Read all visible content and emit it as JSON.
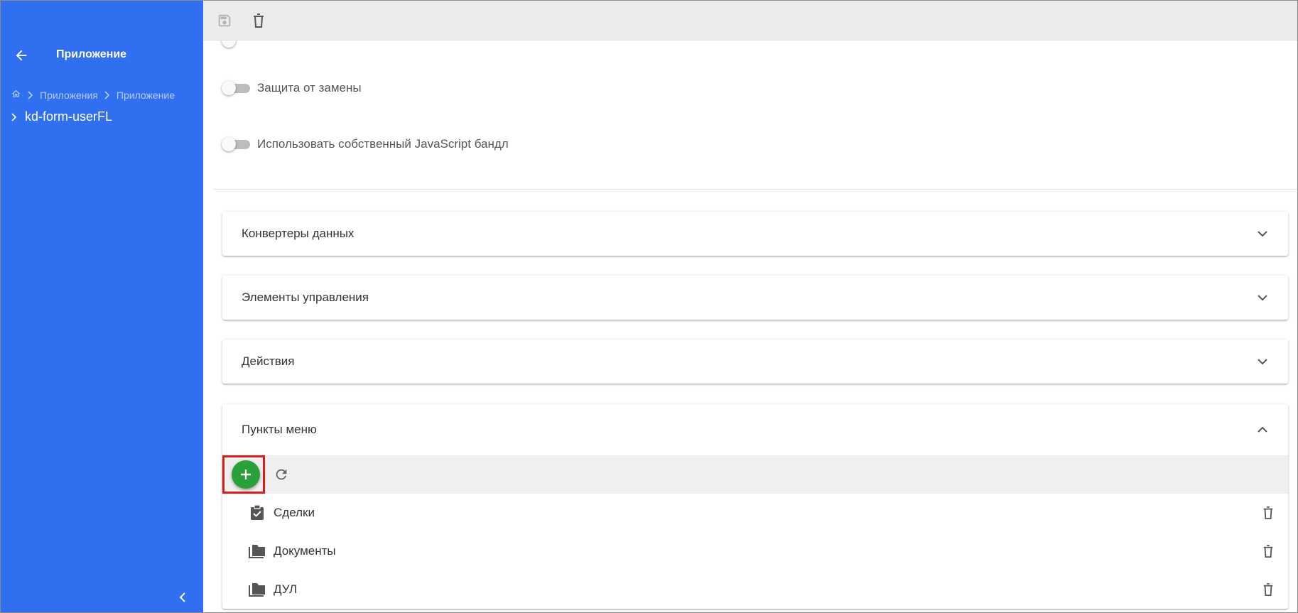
{
  "sidebar": {
    "title": "Приложение",
    "breadcrumb": [
      "Приложения",
      "Приложение"
    ],
    "tree_item": "kd-form-userFL",
    "icons": {
      "back": "arrow-left-icon",
      "home": "home-icon",
      "collapse": "chevron-left-icon"
    },
    "color": "#2f6ff0"
  },
  "topbar": {
    "icons": [
      "save-icon",
      "trash-icon"
    ]
  },
  "toggles": [
    {
      "label": "Защита от замены",
      "checked": false
    },
    {
      "label": "Использовать собственный JavaScript бандл",
      "checked": false
    }
  ],
  "panels": [
    {
      "title": "Конвертеры данных",
      "expanded": false
    },
    {
      "title": "Элементы управления",
      "expanded": false
    },
    {
      "title": "Действия",
      "expanded": false
    },
    {
      "title": "Пункты меню",
      "expanded": true
    }
  ],
  "menu_items": [
    {
      "label": "Сделки",
      "icon": "clipboard-check-icon"
    },
    {
      "label": "Документы",
      "icon": "folders-icon"
    },
    {
      "label": "ДУЛ",
      "icon": "folders-icon"
    }
  ],
  "colors": {
    "add_button": "#2aa03a",
    "highlight_border": "#e01919"
  }
}
